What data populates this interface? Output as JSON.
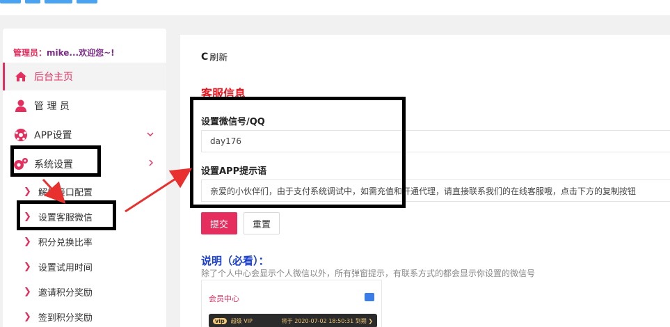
{
  "sidebar": {
    "admin_prefix": "管理员：",
    "admin_name": "mike...",
    "admin_welcome": "欢迎您~!",
    "items": [
      {
        "label": "后台主页",
        "icon": "home-icon",
        "active": true
      },
      {
        "label": "管 理 员",
        "icon": "user-icon"
      },
      {
        "label": "APP设置",
        "icon": "soccer-ball-icon",
        "expand": "chevron-down-icon"
      },
      {
        "label": "系统设置",
        "icon": "gears-icon",
        "expand": "chevron-right-icon"
      }
    ],
    "subitems": [
      {
        "label": "解析接口配置"
      },
      {
        "label": "设置客服微信"
      },
      {
        "label": "积分兑换比率"
      },
      {
        "label": "设置试用时间"
      },
      {
        "label": "邀请积分奖励"
      },
      {
        "label": "签到积分奖励"
      }
    ]
  },
  "main": {
    "refresh_icon": "C",
    "refresh_label": "刷新",
    "section_title": "客服信息",
    "wechat_label": "设置微信号/QQ",
    "wechat_value": "day176",
    "tip_label": "设置APP提示语",
    "tip_value": "亲爱的小伙伴们，由于支付系统调试中，如需充值和开通代理，请直接联系我们的在线客服哦，点击下方的复制按钮",
    "submit_label": "提交",
    "reset_label": "重置",
    "note_title": "说明（必看）：",
    "note_text": "除了个人中心会显示个人微信以外，所有弹窗提示，有联系方式的都会显示你设置的微信号",
    "preview": {
      "header": "会员中心",
      "vip_badge": "vip",
      "vip_label": "超级 VIP",
      "expiry": "将于 2020-07-02 18:50:31 到期 ❯"
    }
  },
  "colors": {
    "accent": "#e52e5d",
    "section_title": "#e5141e",
    "note_title": "#1a3fd0",
    "annotation": "#000000",
    "arrow": "#e8312f"
  }
}
